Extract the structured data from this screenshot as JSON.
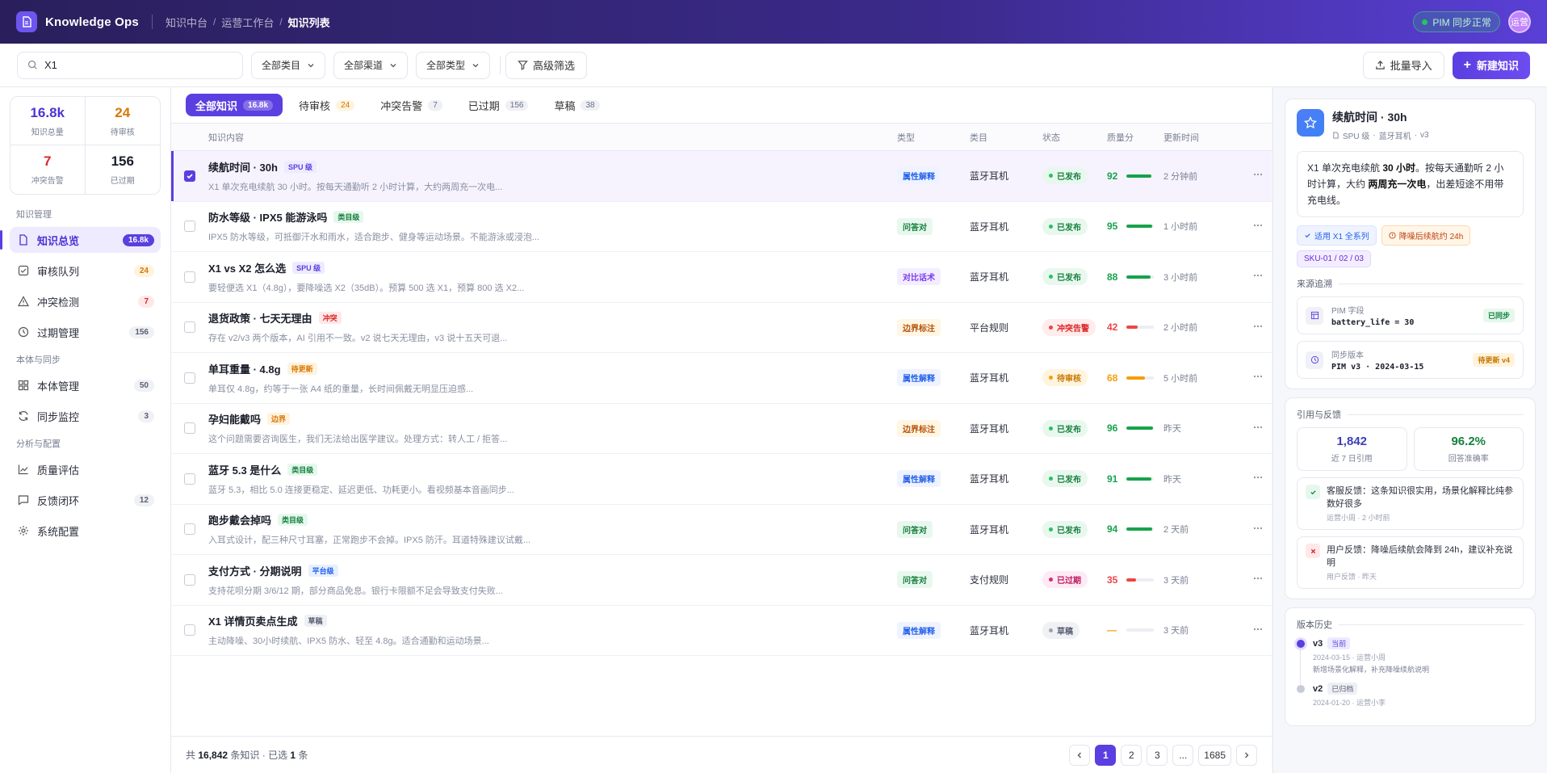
{
  "app": {
    "title": "Knowledge Ops"
  },
  "breadcrumb": [
    "知识中台",
    "运营工作台",
    "知识列表"
  ],
  "header": {
    "sync_status": "PIM 同步正常",
    "avatar": "运营"
  },
  "toolbar": {
    "search_value": "X1",
    "filters": [
      "全部类目",
      "全部渠道",
      "全部类型"
    ],
    "advanced_filter": "高级筛选",
    "import_label": "批量导入",
    "new_label": "新建知识"
  },
  "sidebar": {
    "stats": [
      {
        "value": "16.8k",
        "label": "知识总量",
        "color": "#4d32d6"
      },
      {
        "value": "24",
        "label": "待审核",
        "color": "#d97706"
      },
      {
        "value": "7",
        "label": "冲突告警",
        "color": "#dc2626"
      },
      {
        "value": "156",
        "label": "已过期",
        "color": "#1a1d29"
      }
    ],
    "groups": [
      {
        "label": "知识管理",
        "items": [
          {
            "label": "知识总览",
            "badge": "16.8k",
            "icon": "file-icon"
          },
          {
            "label": "审核队列",
            "badge": "24",
            "icon": "check-square-icon"
          },
          {
            "label": "冲突检测",
            "badge": "7",
            "icon": "alert-triangle-icon"
          },
          {
            "label": "过期管理",
            "badge": "156",
            "icon": "clock-icon"
          }
        ]
      },
      {
        "label": "本体与同步",
        "items": [
          {
            "label": "本体管理",
            "badge": "50",
            "icon": "grid-icon"
          },
          {
            "label": "同步监控",
            "badge": "3",
            "icon": "refresh-icon"
          }
        ]
      },
      {
        "label": "分析与配置",
        "items": [
          {
            "label": "质量评估",
            "badge": "",
            "icon": "chart-line-icon"
          },
          {
            "label": "反馈闭环",
            "badge": "12",
            "icon": "message-icon"
          },
          {
            "label": "系统配置",
            "badge": "",
            "icon": "gear-icon"
          }
        ]
      }
    ]
  },
  "tabs": [
    {
      "label": "全部知识",
      "count": "16.8k"
    },
    {
      "label": "待审核",
      "count": "24"
    },
    {
      "label": "冲突告警",
      "count": "7"
    },
    {
      "label": "已过期",
      "count": "156"
    },
    {
      "label": "草稿",
      "count": "38"
    }
  ],
  "table": {
    "columns": [
      "知识内容",
      "类型",
      "类目",
      "状态",
      "质量分",
      "更新时间"
    ],
    "rows": [
      {
        "title": "续航时间 · 30h",
        "tag": "SPU 级",
        "desc": "X1 单次充电续航 30 小时。按每天通勤听 2 小时计算，大约两周充一次电...",
        "type": "属性解释",
        "category": "蓝牙耳机",
        "status": "已发布",
        "score": "92",
        "score_pct": 92,
        "time": "2 分钟前",
        "selected": true
      },
      {
        "title": "防水等级 · IPX5 能游泳吗",
        "tag": "类目级",
        "desc": "IPX5 防水等级，可抵御汗水和雨水，适合跑步、健身等运动场景。不能游泳或浸泡...",
        "type": "问答对",
        "category": "蓝牙耳机",
        "status": "已发布",
        "score": "95",
        "score_pct": 95,
        "time": "1 小时前",
        "selected": false
      },
      {
        "title": "X1 vs X2 怎么选",
        "tag": "SPU 级",
        "desc": "要轻便选 X1（4.8g），要降噪选 X2（35dB）。预算 500 选 X1，预算 800 选 X2...",
        "type": "对比话术",
        "category": "蓝牙耳机",
        "status": "已发布",
        "score": "88",
        "score_pct": 88,
        "time": "3 小时前",
        "selected": false
      },
      {
        "title": "退货政策 · 七天无理由",
        "tag": "冲突",
        "desc": "存在 v2/v3 两个版本，AI 引用不一致。v2 说七天无理由，v3 说十五天可退...",
        "type": "边界标注",
        "category": "平台规则",
        "status": "冲突告警",
        "score": "42",
        "score_pct": 42,
        "time": "2 小时前",
        "selected": false
      },
      {
        "title": "单耳重量 · 4.8g",
        "tag": "待更新",
        "desc": "单耳仅 4.8g，约等于一张 A4 纸的重量，长时间佩戴无明显压迫感...",
        "type": "属性解释",
        "category": "蓝牙耳机",
        "status": "待审核",
        "score": "68",
        "score_pct": 68,
        "time": "5 小时前",
        "selected": false
      },
      {
        "title": "孕妇能戴吗",
        "tag": "边界",
        "desc": "这个问题需要咨询医生，我们无法给出医学建议。处理方式：转人工 / 拒答...",
        "type": "边界标注",
        "category": "蓝牙耳机",
        "status": "已发布",
        "score": "96",
        "score_pct": 96,
        "time": "昨天",
        "selected": false
      },
      {
        "title": "蓝牙 5.3 是什么",
        "tag": "类目级",
        "desc": "蓝牙 5.3，相比 5.0 连接更稳定、延迟更低、功耗更小。看视频基本音画同步...",
        "type": "属性解释",
        "category": "蓝牙耳机",
        "status": "已发布",
        "score": "91",
        "score_pct": 91,
        "time": "昨天",
        "selected": false
      },
      {
        "title": "跑步戴会掉吗",
        "tag": "类目级",
        "desc": "入耳式设计，配三种尺寸耳塞，正常跑步不会掉。IPX5 防汗。耳道特殊建议试戴...",
        "type": "问答对",
        "category": "蓝牙耳机",
        "status": "已发布",
        "score": "94",
        "score_pct": 94,
        "time": "2 天前",
        "selected": false
      },
      {
        "title": "支付方式 · 分期说明",
        "tag": "平台级",
        "desc": "支持花呗分期 3/6/12 期，部分商品免息。银行卡限额不足会导致支付失败...",
        "type": "问答对",
        "category": "支付规则",
        "status": "已过期",
        "score": "35",
        "score_pct": 35,
        "time": "3 天前",
        "selected": false
      },
      {
        "title": "X1 详情页卖点生成",
        "tag": "草稿",
        "desc": "主动降噪、30小时续航、IPX5 防水、轻至 4.8g。适合通勤和运动场景...",
        "type": "属性解释",
        "category": "蓝牙耳机",
        "status": "草稿",
        "score": "—",
        "score_pct": 0,
        "time": "3 天前",
        "selected": false
      }
    ]
  },
  "footer": {
    "prefix": "共",
    "total": "16,842",
    "mid": "条知识 · 已选",
    "selected": "1",
    "suffix": "条",
    "pages": [
      "1",
      "2",
      "3",
      "...",
      "1685"
    ]
  },
  "detail": {
    "title": "续航时间 · 30h",
    "meta": [
      "SPU 级",
      "蓝牙耳机",
      "v3"
    ],
    "body_parts": [
      "X1 单次充电续航 ",
      "30 小时",
      "。按每天通勤听 2 小时计算，大约 ",
      "两周充一次电",
      "，出差短途不用带充电线。"
    ],
    "chips": [
      "适用 X1 全系列",
      "降噪后续航约 24h",
      "SKU-01 / 02 / 03"
    ],
    "source_title": "来源追溯",
    "sources": [
      {
        "label": "PIM 字段",
        "value": "battery_life = 30",
        "badge": "已同步"
      },
      {
        "label": "同步版本",
        "value": "PIM v3 · 2024-03-15",
        "badge": "待更新 v4"
      }
    ]
  },
  "feedback": {
    "title": "引用与反馈",
    "metrics": [
      {
        "value": "1,842",
        "label": "近 7 日引用",
        "color": "#3b3fb6"
      },
      {
        "value": "96.2%",
        "label": "回答准确率",
        "color": "#15803d"
      }
    ],
    "items": [
      {
        "text": "客服反馈：这条知识很实用，场景化解释比纯参数好很多",
        "meta": "运营小周 · 2 小时前",
        "kind": "ok"
      },
      {
        "text": "用户反馈：降噪后续航会降到 24h，建议补充说明",
        "meta": "用户反馈 · 昨天",
        "kind": "no"
      }
    ]
  },
  "versions": {
    "title": "版本历史",
    "items": [
      {
        "name": "v3",
        "tag": "当前",
        "meta": "2024-03-15 · 运营小周",
        "note": "新增场景化解释，补充降噪续航说明"
      },
      {
        "name": "v2",
        "tag": "已归档",
        "meta": "2024-01-20 · 运营小李",
        "note": ""
      }
    ]
  },
  "colors": {
    "accent": "#5b3fe0",
    "header_start": "#2a1f5c",
    "header_end": "#5a3fd6"
  }
}
